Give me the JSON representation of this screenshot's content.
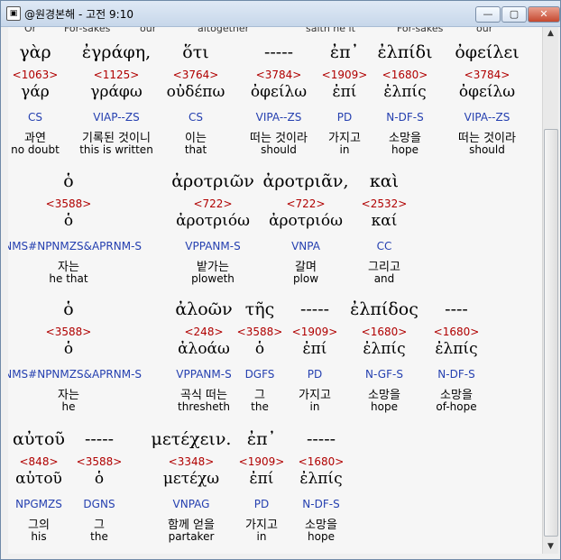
{
  "window": {
    "title": "@원경본해 - 고전 9:10",
    "buttons": {
      "minimize": "—",
      "maximize": "▢",
      "close": "✕"
    }
  },
  "top_cut": [
    "Or",
    "For-sakes",
    "our",
    "altogether",
    "saith he it",
    "For-sakes",
    "our"
  ],
  "rows": [
    {
      "words": [
        {
          "gk": "γὰρ",
          "num": "<1063>",
          "lem": "γάρ",
          "tag": "CS",
          "kr": "과연",
          "en": "no doubt"
        },
        {
          "gk": "ἐγράφη,",
          "num": "<1125>",
          "lem": "γράφω",
          "tag": "VIAP--ZS",
          "kr": "기록된 것이니",
          "en": "this is written"
        },
        {
          "gk": "ὅτι",
          "num": "<3764>",
          "lem": "οὐδέπω",
          "tag": "CS",
          "kr": "이는",
          "en": "that"
        },
        {
          "gk": "-----",
          "num": "<3784>",
          "lem": "ὀφείλω",
          "tag": "VIPA--ZS",
          "kr": "떠는 것이라",
          "en": "should"
        },
        {
          "gk": "ἐπ᾽",
          "num": "<1909>",
          "lem": "ἐπί",
          "tag": "PD",
          "kr": "가지고",
          "en": "in"
        },
        {
          "gk": "ἐλπίδι",
          "num": "<1680>",
          "lem": "ἐλπίς",
          "tag": "N-DF-S",
          "kr": "소망을",
          "en": "hope"
        },
        {
          "gk": "ὀφείλει",
          "num": "<3784>",
          "lem": "ὀφείλω",
          "tag": "VIPA--ZS",
          "kr": "떠는 것이라",
          "en": "should"
        }
      ]
    },
    {
      "words": [
        {
          "gk": "ὁ",
          "num": "<3588>",
          "lem": "ὁ",
          "tag": "DNMS#NPNMZS&APRNM-S",
          "kr": "자는",
          "en": "he that"
        },
        {
          "gk": "ἀροτριῶν",
          "num": "<722>",
          "lem": "ἀροτριόω",
          "tag": "VPPANM-S",
          "kr": "밭가는",
          "en": "ploweth"
        },
        {
          "gk": "ἀροτριᾶν,",
          "num": "<722>",
          "lem": "ἀροτριόω",
          "tag": "VNPA",
          "kr": "갈며",
          "en": "plow"
        },
        {
          "gk": "καὶ",
          "num": "<2532>",
          "lem": "καί",
          "tag": "CC",
          "kr": "그리고",
          "en": "and"
        }
      ]
    },
    {
      "words": [
        {
          "gk": "ὁ",
          "num": "<3588>",
          "lem": "ὁ",
          "tag": "DNMS#NPNMZS&APRNM-S",
          "kr": "자는",
          "en": "he"
        },
        {
          "gk": "ἀλοῶν",
          "num": "<248>",
          "lem": "ἀλοάω",
          "tag": "VPPANM-S",
          "kr": "곡식 떠는",
          "en": "thresheth"
        },
        {
          "gk": "τῆς",
          "num": "<3588>",
          "lem": "ὁ",
          "tag": "DGFS",
          "kr": "그",
          "en": "the"
        },
        {
          "gk": "-----",
          "num": "<1909>",
          "lem": "ἐπί",
          "tag": "PD",
          "kr": "가지고",
          "en": "in"
        },
        {
          "gk": "ἐλπίδος",
          "num": "<1680>",
          "lem": "ἐλπίς",
          "tag": "N-GF-S",
          "kr": "소망을",
          "en": "hope"
        },
        {
          "gk": "----",
          "num": "<1680>",
          "lem": "ἐλπίς",
          "tag": "N-DF-S",
          "kr": "소망을",
          "en": "of-hope"
        }
      ]
    },
    {
      "words": [
        {
          "gk": "αὐτοῦ",
          "num": "<848>",
          "lem": "αὑτοῦ",
          "tag": "NPGMZS",
          "kr": "그의",
          "en": "his"
        },
        {
          "gk": "-----",
          "num": "<3588>",
          "lem": "ὁ",
          "tag": "DGNS",
          "kr": "그",
          "en": "the"
        },
        {
          "gk": "μετέχειν.",
          "num": "<3348>",
          "lem": "μετέχω",
          "tag": "VNPAG",
          "kr": "함께 얻을",
          "en": "partaker"
        },
        {
          "gk": "ἐπ᾽",
          "num": "<1909>",
          "lem": "ἐπί",
          "tag": "PD",
          "kr": "가지고",
          "en": "in"
        },
        {
          "gk": "-----",
          "num": "<1680>",
          "lem": "ἐλπίς",
          "tag": "N-DF-S",
          "kr": "소망을",
          "en": "hope"
        }
      ]
    }
  ]
}
